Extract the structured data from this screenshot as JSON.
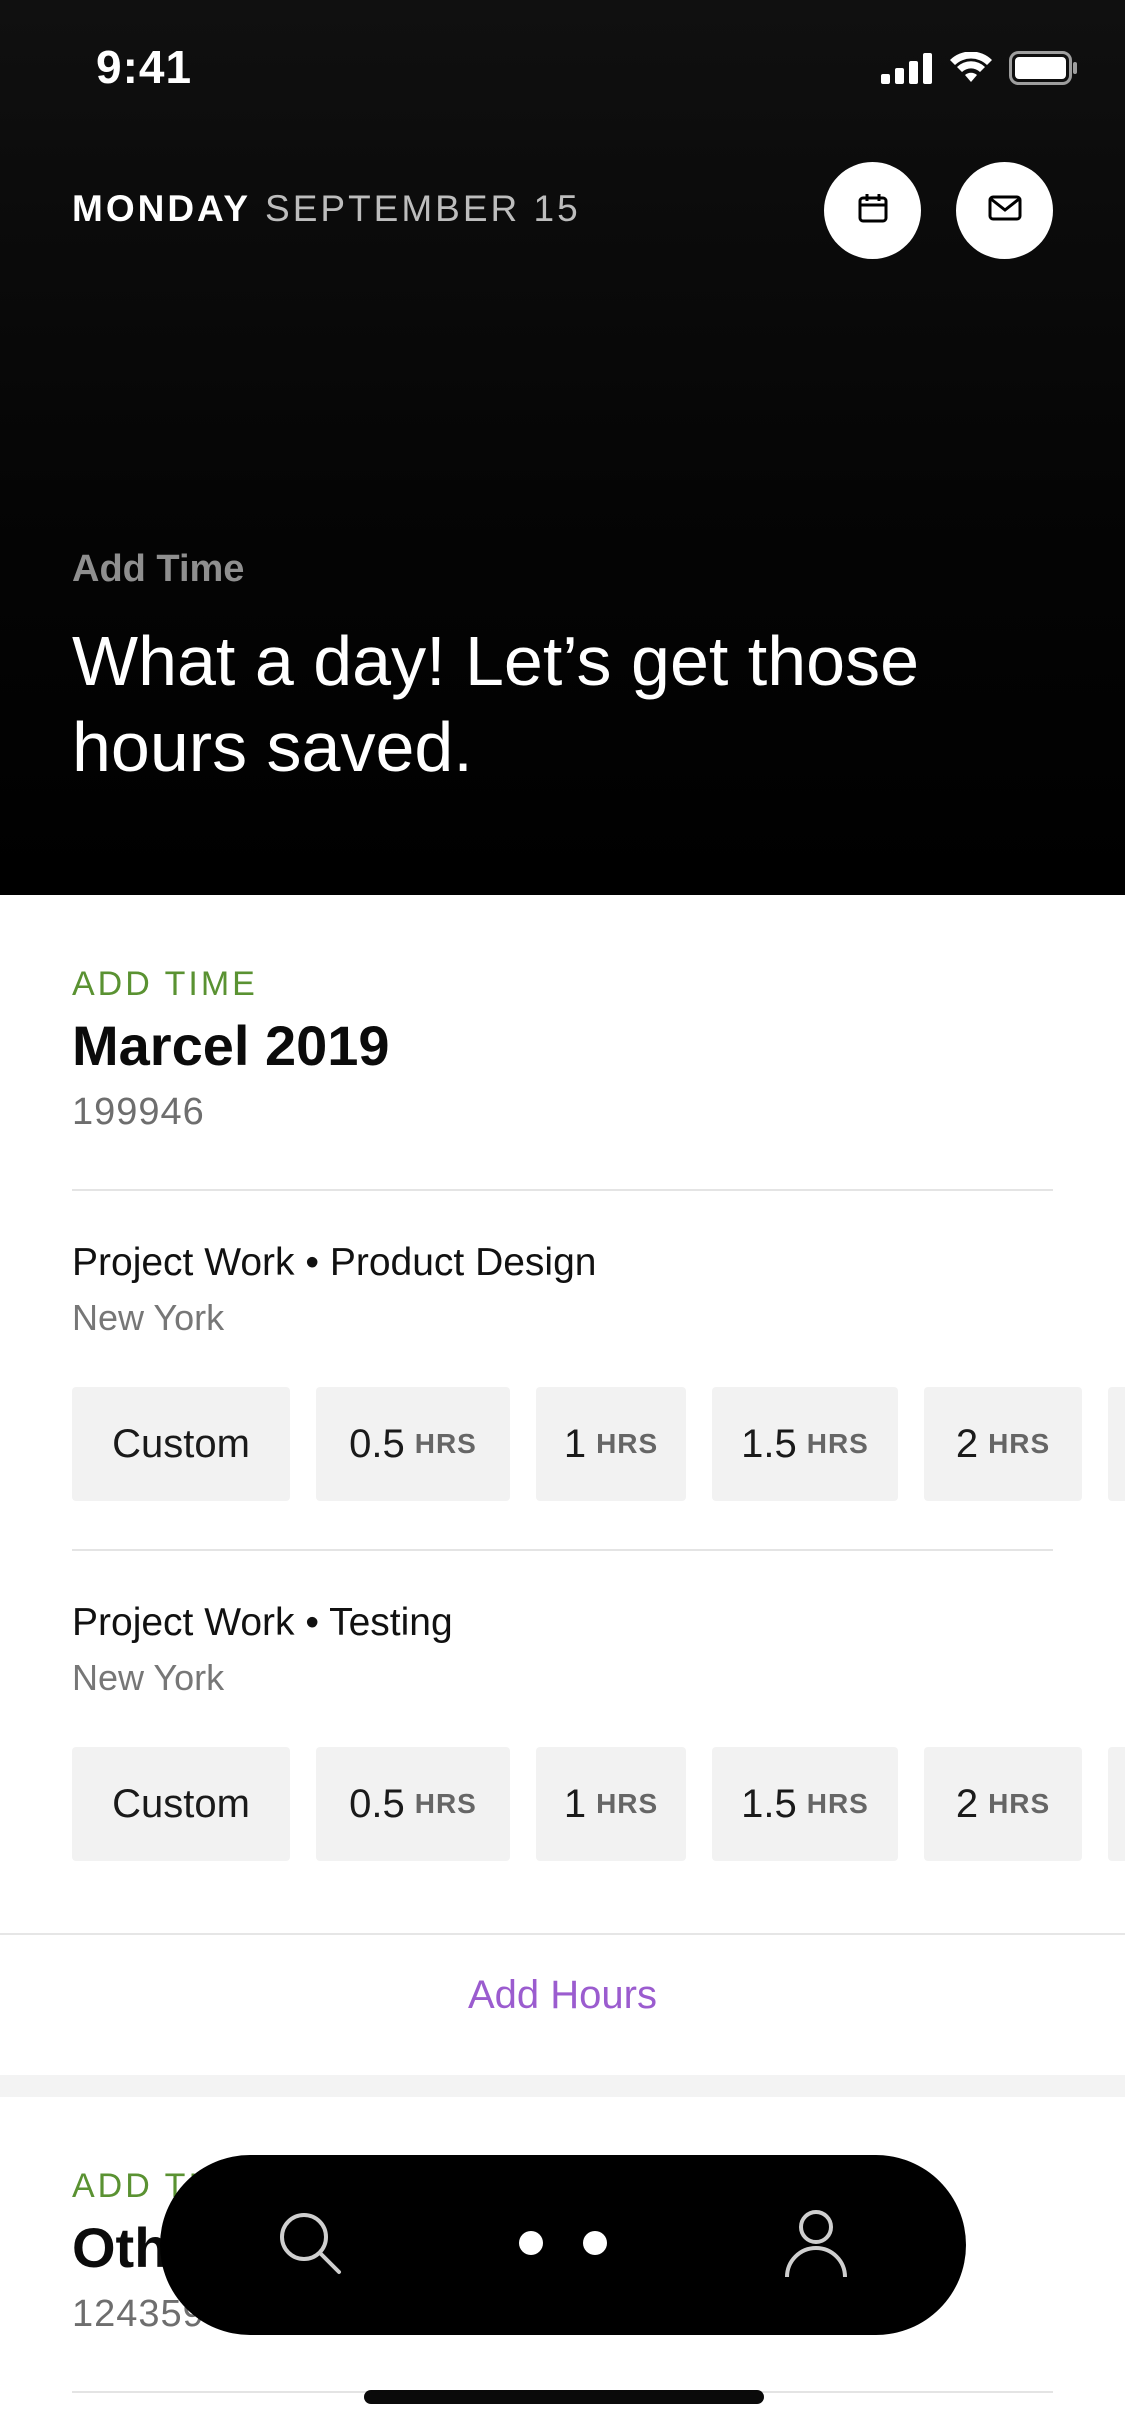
{
  "status_bar": {
    "time": "9:41"
  },
  "header": {
    "day_of_week": "MONDAY",
    "date": "SEPTEMBER 15",
    "subtitle": "Add Time",
    "title": "What a day! Let’s get those hours saved."
  },
  "projects": [
    {
      "eyebrow": "ADD TIME",
      "name": "Marcel 2019",
      "code": "199946",
      "tasks": [
        {
          "title": "Project Work • Product Design",
          "location": "New York",
          "chips": [
            {
              "value": "Custom",
              "unit": ""
            },
            {
              "value": "0.5",
              "unit": "HRS"
            },
            {
              "value": "1",
              "unit": "HRS"
            },
            {
              "value": "1.5",
              "unit": "HRS"
            },
            {
              "value": "2",
              "unit": "HRS"
            }
          ]
        },
        {
          "title": "Project Work • Testing",
          "location": "New York",
          "chips": [
            {
              "value": "Custom",
              "unit": ""
            },
            {
              "value": "0.5",
              "unit": "HRS"
            },
            {
              "value": "1",
              "unit": "HRS"
            },
            {
              "value": "1.5",
              "unit": "HRS"
            },
            {
              "value": "2",
              "unit": "HRS"
            }
          ]
        }
      ],
      "add_hours_label": "Add Hours"
    },
    {
      "eyebrow": "ADD TIME",
      "name": "Other",
      "code": "124359"
    }
  ],
  "nav": {
    "items": [
      "search-icon",
      "more-icon",
      "profile-icon"
    ]
  },
  "colors": {
    "accent_green": "#5a9232",
    "accent_purple": "#9b5ccf",
    "hero_bg": "#050505"
  }
}
